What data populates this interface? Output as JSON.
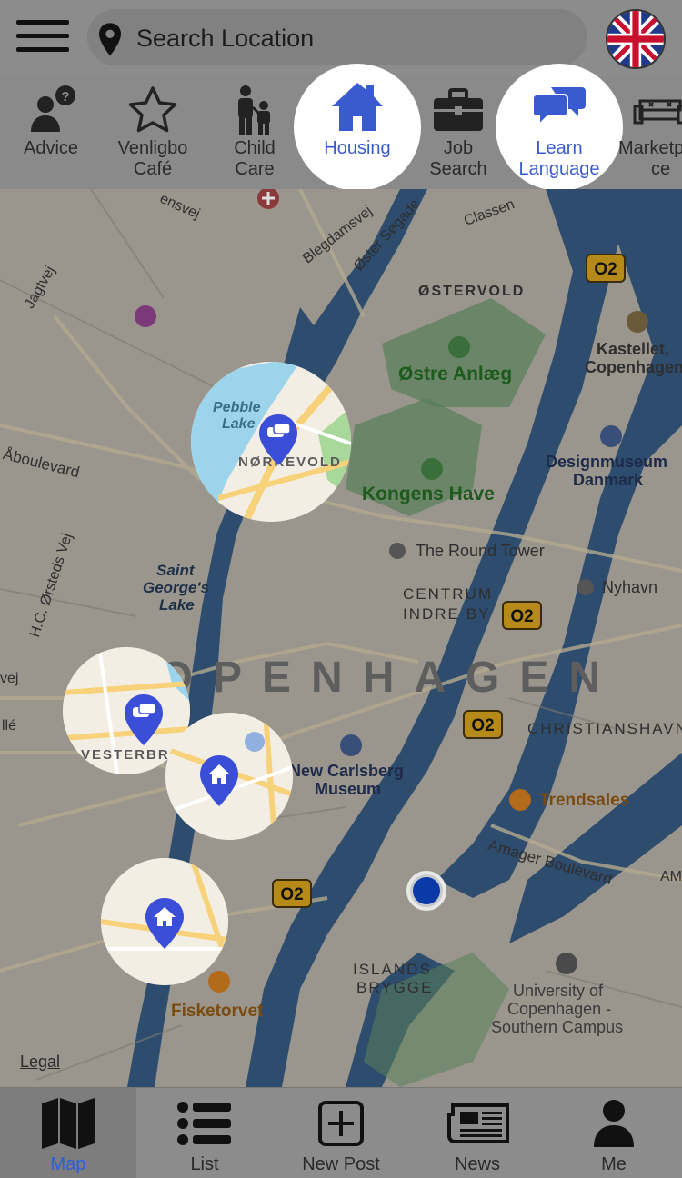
{
  "header": {
    "search_placeholder": "Search Location",
    "language_flag": "uk-flag"
  },
  "categories": [
    {
      "label": "Advice",
      "icon": "advice-icon"
    },
    {
      "label": "Venligbo Café",
      "icon": "star-icon"
    },
    {
      "label": "Child Care",
      "icon": "child-care-icon"
    },
    {
      "label": "Housing",
      "icon": "house-icon",
      "selected": true
    },
    {
      "label": "Job Search",
      "icon": "briefcase-icon"
    },
    {
      "label": "Learn Language",
      "icon": "chat-bubbles-icon",
      "selected": true
    },
    {
      "label": "Marketplace",
      "icon": "sofa-icon"
    }
  ],
  "map": {
    "city_label": "COPENHAGEN",
    "labels": {
      "ostervold": "ØSTERVOLD",
      "ostre_anlaeg": "Østre Anlæg",
      "kongens_have": "Kongens Have",
      "round_tower": "The Round Tower",
      "centrum": "CENTRUM",
      "indre_by": "INDRE BY",
      "christianshavn": "CHRISTIANSHAVN",
      "carlsberg": "New Carlsberg",
      "carlsberg2": "Museum",
      "trendsales": "Trendsales",
      "designmuseum": "Designmuseum",
      "designmuseum2": "Danmark",
      "kastellet": "Kastellet,",
      "kastellet2": "Copenhagen",
      "nyhavn": "Nyhavn",
      "saint_georges": "Saint",
      "saint_georges2": "George's",
      "saint_georges3": "Lake",
      "islands_brygge": "ISLANDS",
      "islands_brygge2": "BRYGGE",
      "university": "University of",
      "university2": "Copenhagen -",
      "university3": "Southern Campus",
      "fisketorvet": "Fisketorvet",
      "oster_sogade": "Øster Søgade",
      "blegdamsvej": "Blegdamsvej",
      "jagtvej": "Jagtvej",
      "aboulevard": "Åboulevard",
      "hc_orsteds": "H.C. Ørsteds Vej",
      "amager_boulevard": "Amager Boulevard",
      "classen": "Classen",
      "nsvej": "ensvej",
      "pebble_lake": "Pebble",
      "pebble_lake2": "Lake",
      "norrevold": "NØRREVOLD",
      "vesterbro": "VESTERBRO",
      "metro_o2": "O2",
      "legal": "Legal",
      "vej": "vej",
      "lle": "llé",
      "am": "AM",
      "marketplace_ce": "ce"
    }
  },
  "tabs": [
    {
      "label": "Map",
      "icon": "map-icon",
      "active": true
    },
    {
      "label": "List",
      "icon": "list-icon"
    },
    {
      "label": "New Post",
      "icon": "add-post-icon"
    },
    {
      "label": "News",
      "icon": "newspaper-icon"
    },
    {
      "label": "Me",
      "icon": "person-icon"
    }
  ],
  "colors": {
    "accent": "#3a5bd0",
    "active_tab": "#2b5fd9",
    "user_location": "#0a3aa8"
  }
}
